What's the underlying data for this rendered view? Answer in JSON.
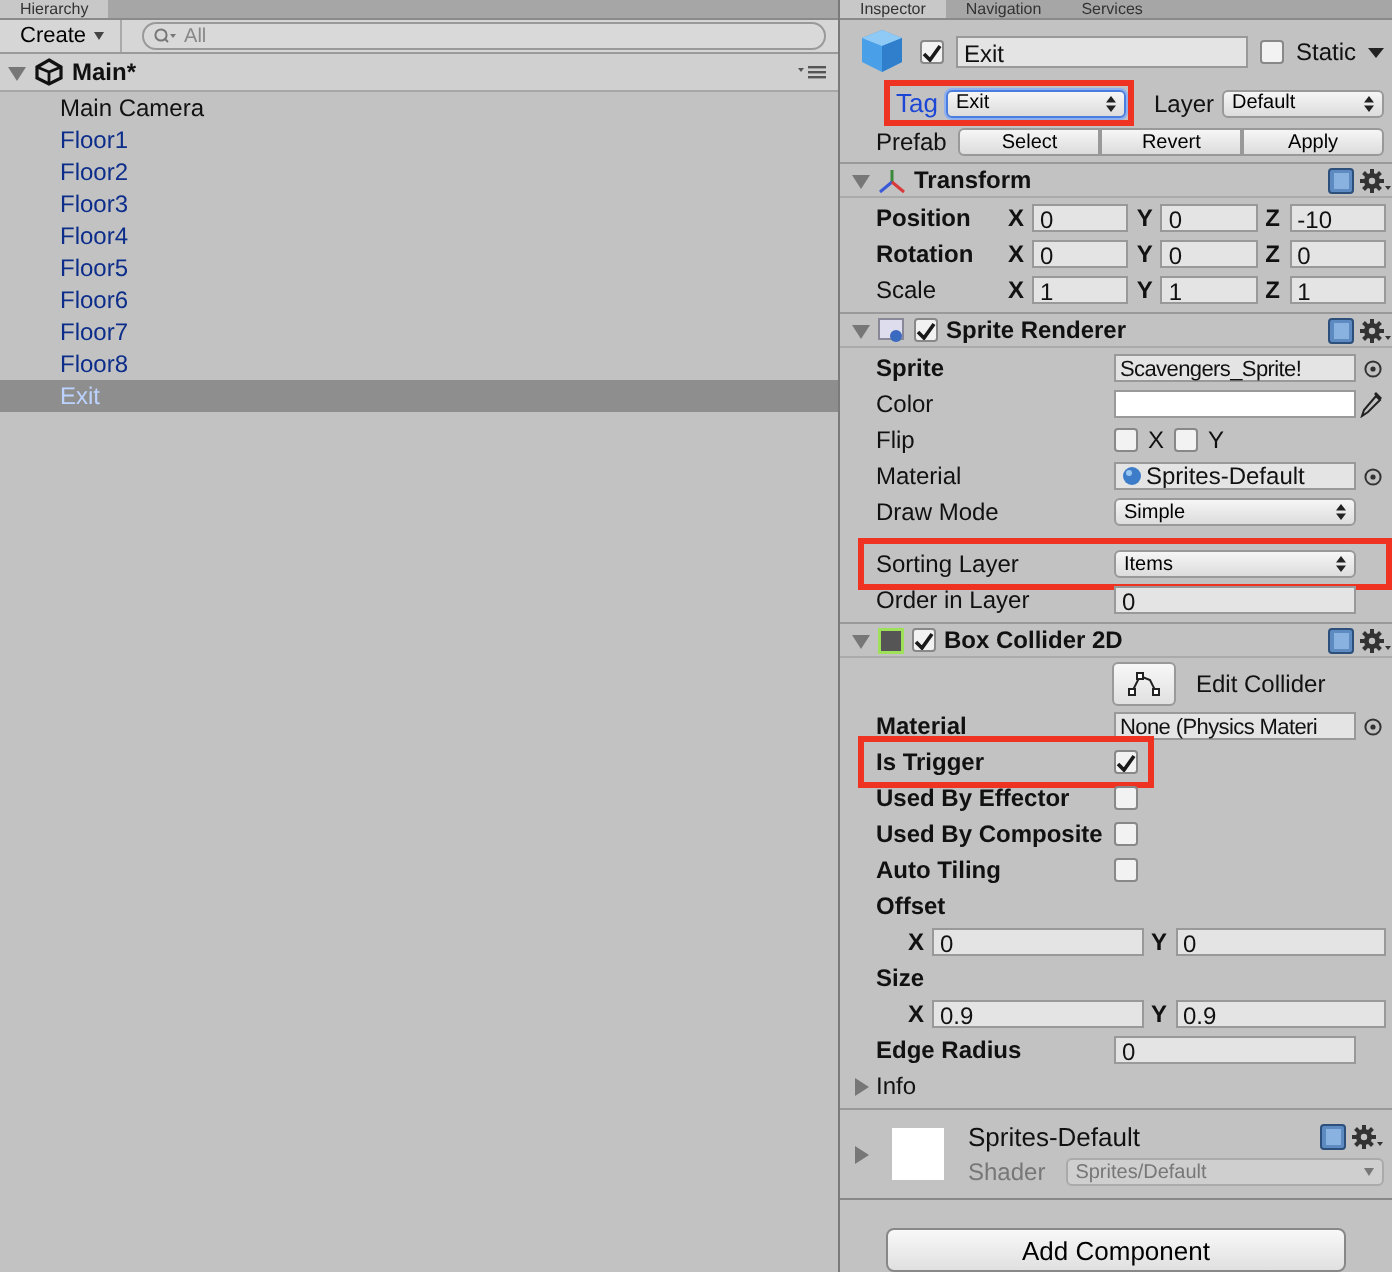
{
  "hierarchy": {
    "tab": "Hierarchy",
    "create_button": "Create",
    "search": {
      "placeholder": "All"
    },
    "scene": {
      "name": "Main*",
      "expanded": true
    },
    "items": [
      {
        "name": "Main Camera",
        "kind": "object",
        "selected": false
      },
      {
        "name": "Floor1",
        "kind": "prefab",
        "selected": false
      },
      {
        "name": "Floor2",
        "kind": "prefab",
        "selected": false
      },
      {
        "name": "Floor3",
        "kind": "prefab",
        "selected": false
      },
      {
        "name": "Floor4",
        "kind": "prefab",
        "selected": false
      },
      {
        "name": "Floor5",
        "kind": "prefab",
        "selected": false
      },
      {
        "name": "Floor6",
        "kind": "prefab",
        "selected": false
      },
      {
        "name": "Floor7",
        "kind": "prefab",
        "selected": false
      },
      {
        "name": "Floor8",
        "kind": "prefab",
        "selected": false
      },
      {
        "name": "Exit",
        "kind": "prefab",
        "selected": true
      }
    ]
  },
  "inspector": {
    "tabs": [
      {
        "label": "Inspector",
        "selected": true
      },
      {
        "label": "Navigation",
        "selected": false
      },
      {
        "label": "Services",
        "selected": false
      }
    ],
    "object": {
      "active": true,
      "name": "Exit",
      "static_label": "Static",
      "static": false,
      "tag_label": "Tag",
      "tag": "Exit",
      "tag_highlighted": true,
      "layer_label": "Layer",
      "layer": "Default",
      "prefab_label": "Prefab",
      "prefab_buttons": [
        "Select",
        "Revert",
        "Apply"
      ]
    },
    "components": [
      {
        "kind": "transform",
        "name": "Transform",
        "expanded": true,
        "rows": [
          {
            "kind": "vector",
            "label": "Position",
            "bold": true,
            "axes": [
              {
                "axis": "X",
                "value": "0"
              },
              {
                "axis": "Y",
                "value": "0"
              },
              {
                "axis": "Z",
                "value": "-10"
              }
            ]
          },
          {
            "kind": "vector",
            "label": "Rotation",
            "bold": true,
            "axes": [
              {
                "axis": "X",
                "value": "0"
              },
              {
                "axis": "Y",
                "value": "0"
              },
              {
                "axis": "Z",
                "value": "0"
              }
            ]
          },
          {
            "kind": "vector",
            "label": "Scale",
            "bold": false,
            "axes": [
              {
                "axis": "X",
                "value": "1"
              },
              {
                "axis": "Y",
                "value": "1"
              },
              {
                "axis": "Z",
                "value": "1"
              }
            ]
          }
        ]
      },
      {
        "kind": "sprite",
        "name": "Sprite Renderer",
        "enabled": true,
        "expanded": true,
        "rows": [
          {
            "kind": "object",
            "label": "Sprite",
            "bold": true,
            "value": "Scavengers_Sprite!",
            "highlighted": false
          },
          {
            "kind": "color",
            "label": "Color",
            "bold": false,
            "highlighted": false
          },
          {
            "kind": "flip",
            "label": "Flip",
            "bold": false,
            "highlighted": false,
            "checks": [
              {
                "axis": "X",
                "checked": false
              },
              {
                "axis": "Y",
                "checked": false
              }
            ]
          },
          {
            "kind": "material",
            "label": "Material",
            "bold": false,
            "value": "Sprites-Default",
            "highlighted": false
          },
          {
            "kind": "dropdown",
            "label": "Draw Mode",
            "bold": false,
            "value": "Simple",
            "highlighted": false
          },
          {
            "kind": "dropdown",
            "label": "Sorting Layer",
            "bold": false,
            "value": "Items",
            "highlighted": true
          },
          {
            "kind": "number",
            "label": "Order in Layer",
            "bold": false,
            "value": "0",
            "highlighted": false
          }
        ]
      },
      {
        "kind": "collider",
        "name": "Box Collider 2D",
        "enabled": true,
        "expanded": true,
        "rows": [
          {
            "kind": "button",
            "label": "Edit Collider"
          },
          {
            "kind": "object",
            "label": "Material",
            "bold": true,
            "value": "None (Physics Materi",
            "highlighted": false
          },
          {
            "kind": "checkbox",
            "label": "Is Trigger",
            "bold": true,
            "checked": true,
            "highlighted": true
          },
          {
            "kind": "checkbox",
            "label": "Used By Effector",
            "bold": true,
            "checked": false,
            "highlighted": false
          },
          {
            "kind": "checkbox",
            "label": "Used By Composite",
            "bold": true,
            "checked": false,
            "highlighted": false
          },
          {
            "kind": "checkbox",
            "label": "Auto Tiling",
            "bold": true,
            "checked": false,
            "highlighted": false
          },
          {
            "kind": "vector2",
            "label": "Offset",
            "bold": true,
            "axes": [
              {
                "axis": "X",
                "value": "0"
              },
              {
                "axis": "Y",
                "value": "0"
              }
            ]
          },
          {
            "kind": "vector2",
            "label": "Size",
            "bold": true,
            "axes": [
              {
                "axis": "X",
                "value": "0.9"
              },
              {
                "axis": "Y",
                "value": "0.9"
              }
            ]
          },
          {
            "kind": "number",
            "label": "Edge Radius",
            "bold": true,
            "value": "0",
            "highlighted": false
          },
          {
            "kind": "foldout",
            "label": "Info",
            "expanded": false
          }
        ]
      }
    ],
    "material": {
      "name": "Sprites-Default",
      "expanded": false,
      "shader_label": "Shader",
      "shader": "Sprites/Default"
    },
    "add_component": "Add Component"
  }
}
